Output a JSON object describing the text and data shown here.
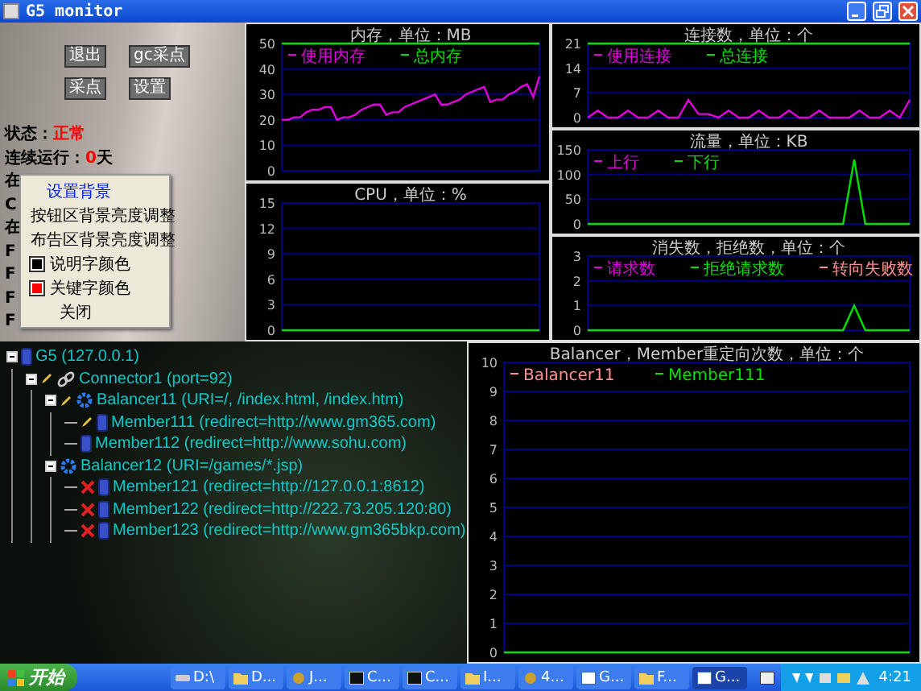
{
  "window": {
    "title": "G5 monitor"
  },
  "control_panel": {
    "buttons": [
      "退出",
      "gc采点",
      "采点",
      "设置"
    ],
    "status_lines": [
      {
        "label": "状态：",
        "value": "正常"
      },
      {
        "label": "连续运行：",
        "value": "0",
        "unit": "天"
      }
    ],
    "covered_lines": [
      "在",
      "C",
      "在",
      "F",
      "F",
      "F",
      "F"
    ]
  },
  "context_menu": {
    "items": [
      {
        "label": "设置背景",
        "kind": "plain",
        "selected": true
      },
      {
        "label": "按钮区背景亮度调整",
        "kind": "plain",
        "selected": false
      },
      {
        "label": "布告区背景亮度调整",
        "kind": "plain",
        "selected": false
      },
      {
        "label": "说明字颜色",
        "kind": "swatch",
        "color": "#000000",
        "selected": false
      },
      {
        "label": "关键字颜色",
        "kind": "swatch",
        "color": "#ff0000",
        "selected": false
      },
      {
        "label": "关闭",
        "kind": "indent",
        "selected": false
      }
    ]
  },
  "middle_charts": [
    {
      "chart_data": {
        "type": "line",
        "title": "内存，单位：MB",
        "grid": true,
        "legend": "top-left",
        "ylim": [
          0,
          50
        ],
        "yticks": [
          0,
          10,
          20,
          30,
          40,
          50
        ],
        "series": [
          {
            "name": "使用内存",
            "color": "#e000e0",
            "values": [
              20,
              20,
              21,
              21,
              23,
              24,
              24,
              25,
              25,
              20,
              21,
              21,
              22,
              24,
              25,
              26,
              26,
              22,
              23,
              23,
              25,
              26,
              27,
              28,
              29,
              30,
              26,
              26,
              27,
              28,
              30,
              31,
              32,
              33,
              27,
              28,
              28,
              30,
              31,
              33,
              34,
              29,
              37
            ]
          },
          {
            "name": "总内存",
            "color": "#00e000",
            "values": [
              50,
              50,
              50,
              50,
              50,
              50,
              50,
              50,
              50,
              50,
              50,
              50,
              50,
              50,
              50,
              50,
              50,
              50,
              50,
              50,
              50,
              50,
              50,
              50,
              50,
              50,
              50,
              50,
              50,
              50,
              50,
              50,
              50,
              50,
              50,
              50,
              50,
              50,
              50,
              50,
              50,
              50,
              50
            ]
          }
        ]
      }
    },
    {
      "chart_data": {
        "type": "line",
        "title": "CPU，单位：%",
        "grid": true,
        "ylim": [
          0,
          15
        ],
        "yticks": [
          0,
          3,
          6,
          9,
          12,
          15
        ],
        "series": [
          {
            "color": "#00e000",
            "values": [
              0,
              0,
              0,
              0,
              0,
              0,
              0,
              0,
              0,
              0,
              0,
              0,
              0,
              0,
              0,
              0,
              0,
              0,
              0,
              0
            ]
          }
        ]
      }
    }
  ],
  "right_charts": [
    {
      "chart_data": {
        "type": "line",
        "title": "连接数，单位：个",
        "grid": true,
        "legend": "top-left",
        "ylim": [
          0,
          21
        ],
        "yticks": [
          0,
          7,
          14,
          21
        ],
        "series": [
          {
            "name": "使用连接",
            "color": "#e000e0",
            "values": [
              0,
              2,
              0,
              0,
              2,
              0,
              0,
              2,
              0,
              0,
              5,
              1,
              1,
              0,
              2,
              0,
              0,
              2,
              0,
              0,
              2,
              0,
              0,
              2,
              0,
              0,
              0,
              2,
              0,
              0,
              2,
              0,
              5
            ]
          },
          {
            "name": "总连接",
            "color": "#00e000",
            "values": [
              21,
              21,
              21,
              21,
              21,
              21,
              21,
              21,
              21,
              21,
              21,
              21,
              21,
              21,
              21,
              21,
              21,
              21,
              21,
              21,
              21,
              21,
              21,
              21,
              21,
              21,
              21,
              21,
              21,
              21,
              21,
              21,
              21
            ]
          }
        ]
      }
    },
    {
      "chart_data": {
        "type": "line",
        "title": "流量，单位：KB",
        "grid": true,
        "legend": "top-left",
        "ylim": [
          0,
          150
        ],
        "yticks": [
          0,
          50,
          100,
          150
        ],
        "series": [
          {
            "name": "上行",
            "color": "#e000e0",
            "values": [
              null,
              null,
              null,
              null,
              null,
              null,
              null,
              null,
              null,
              null,
              null,
              null,
              null,
              null,
              null,
              null,
              null,
              null,
              null,
              null,
              null,
              null,
              null,
              null,
              null,
              null,
              null,
              null,
              null,
              null
            ]
          },
          {
            "name": "下行",
            "color": "#00e000",
            "values": [
              0,
              0,
              0,
              0,
              0,
              0,
              0,
              0,
              0,
              0,
              0,
              0,
              0,
              0,
              0,
              0,
              0,
              0,
              0,
              0,
              0,
              0,
              0,
              0,
              130,
              0,
              0,
              0,
              0,
              0
            ]
          }
        ]
      }
    },
    {
      "chart_data": {
        "type": "line",
        "title": "消失数，拒绝数，单位：个",
        "grid": true,
        "legend": "top-left",
        "ylim": [
          0,
          3
        ],
        "yticks": [
          0,
          1,
          2,
          3
        ],
        "series": [
          {
            "name": "请求数",
            "color": "#e000e0",
            "values": [
              null,
              null,
              null,
              null,
              null,
              null,
              null,
              null,
              null,
              null,
              null,
              null,
              null,
              null,
              null,
              null,
              null,
              null,
              null,
              null,
              null,
              null,
              null,
              null,
              null,
              null,
              null,
              null,
              null,
              null
            ]
          },
          {
            "name": "拒绝请求数",
            "color": "#00e000",
            "values": [
              0,
              0,
              0,
              0,
              0,
              0,
              0,
              0,
              0,
              0,
              0,
              0,
              0,
              0,
              0,
              0,
              0,
              0,
              0,
              0,
              0,
              0,
              0,
              0,
              1,
              0,
              0,
              0,
              0,
              0
            ]
          },
          {
            "name": "转向失败数",
            "color": "#ff9090",
            "values": [
              null,
              null,
              null,
              null,
              null,
              null,
              null,
              null,
              null,
              null,
              null,
              null,
              null,
              null,
              null,
              null,
              null,
              null,
              null,
              null,
              null,
              null,
              null,
              null,
              null,
              null,
              null,
              null,
              null,
              null
            ]
          }
        ]
      }
    }
  ],
  "bottom_chart": {
    "chart_data": {
      "type": "line",
      "title": "Balancer，Member重定向次数，单位：个",
      "grid": true,
      "legend": "top-left",
      "ylim": [
        0,
        10
      ],
      "yticks": [
        0,
        1,
        2,
        3,
        4,
        5,
        6,
        7,
        8,
        9,
        10
      ],
      "series": [
        {
          "name": "Balancer11",
          "color": "#ff9090",
          "values": [
            null,
            null,
            null,
            null,
            null,
            null,
            null,
            null,
            null,
            null
          ]
        },
        {
          "name": "Member111",
          "color": "#00e000",
          "values": [
            0,
            0,
            0,
            0,
            0,
            0,
            0,
            0,
            0,
            0
          ]
        }
      ]
    }
  },
  "tree": {
    "nodes": [
      {
        "label": "G5 (127.0.0.1)",
        "kind": "server",
        "expanded": true,
        "children": [
          {
            "label": "Connector1 (port=92)",
            "kind": "connector",
            "marker": {
              "kind": "pencil"
            },
            "expanded": true,
            "children": [
              {
                "label": "Balancer11 (URI=/, /index.html, /index.htm)",
                "kind": "balancer",
                "marker": {
                  "kind": "pencil"
                },
                "expanded": true,
                "children": [
                  {
                    "label": "Member111 (redirect=http://www.gm365.com)",
                    "kind": "server",
                    "marker": {
                      "kind": "pencil"
                    }
                  },
                  {
                    "label": "Member112 (redirect=http://www.sohu.com)",
                    "kind": "server"
                  }
                ]
              },
              {
                "label": "Balancer12 (URI=/games/*.jsp)",
                "kind": "balancer",
                "expanded": true,
                "children": [
                  {
                    "label": "Member121 (redirect=http://127.0.0.1:8612)",
                    "kind": "server",
                    "marker": {
                      "kind": "error"
                    }
                  },
                  {
                    "label": "Member122 (redirect=http://222.73.205.120:80)",
                    "kind": "server",
                    "marker": {
                      "kind": "error"
                    }
                  },
                  {
                    "label": "Member123 (redirect=http://www.gm365bkp.com)",
                    "kind": "server",
                    "marker": {
                      "kind": "error"
                    }
                  }
                ]
              }
            ]
          }
        ]
      }
    ]
  },
  "taskbar": {
    "start": "开始",
    "items": [
      {
        "label": "D:\\",
        "kind": "drive",
        "selected": false
      },
      {
        "label": "D...",
        "kind": "folder",
        "selected": false
      },
      {
        "label": "J...",
        "kind": "app",
        "selected": false
      },
      {
        "label": "C...",
        "kind": "console",
        "selected": false
      },
      {
        "label": "C...",
        "kind": "console",
        "selected": false
      },
      {
        "label": "I...",
        "kind": "folder",
        "selected": false
      },
      {
        "label": "4...",
        "kind": "app",
        "selected": false
      },
      {
        "label": "G...",
        "kind": "window",
        "selected": false
      },
      {
        "label": "F...",
        "kind": "folder",
        "selected": false
      },
      {
        "label": "G...",
        "kind": "window",
        "selected": true
      }
    ],
    "clock": "4:21"
  }
}
